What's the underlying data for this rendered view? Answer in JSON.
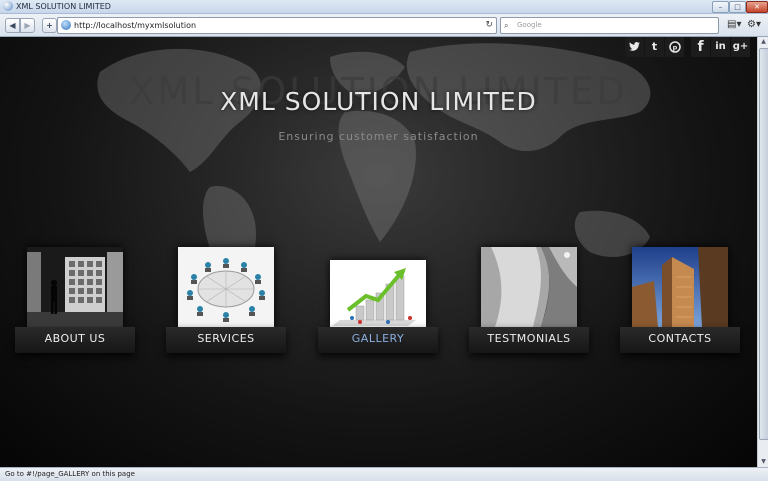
{
  "window": {
    "title": "XML SOLUTION LIMITED",
    "min": "–",
    "max": "□",
    "close": "✕"
  },
  "toolbar": {
    "back": "◀",
    "forward": "▶",
    "add": "+",
    "url": "http://localhost/myxmlsolution",
    "reload": "↻",
    "search_icon": "⌕",
    "search_placeholder": "Google",
    "page_icon": "▤▾",
    "tools_icon": "⚙▾"
  },
  "page": {
    "bg_text": "XML SOLUTION LIMITED",
    "title": "XML SOLUTION LIMITED",
    "tagline": "Ensuring customer satisfaction",
    "social": [
      {
        "icon": "twitter-icon",
        "glyph": "🐦"
      },
      {
        "icon": "tumblr-icon",
        "glyph": "t"
      },
      {
        "icon": "pinterest-icon",
        "glyph": "℗"
      },
      {
        "icon": "facebook-icon",
        "glyph": "f"
      },
      {
        "icon": "linkedin-icon",
        "glyph": "in"
      },
      {
        "icon": "googleplus-icon",
        "glyph": "g+"
      }
    ],
    "nav": [
      {
        "label": "ABOUT US",
        "image": "server-room"
      },
      {
        "label": "SERVICES",
        "image": "meeting-table"
      },
      {
        "label": "GALLERY",
        "image": "growth-chart",
        "active": true
      },
      {
        "label": "TESTMONIALS",
        "image": "white-tunnel"
      },
      {
        "label": "CONTACTS",
        "image": "skyscrapers"
      }
    ],
    "active_color": "#8aaee0"
  },
  "status": "Go to #!/page_GALLERY on this page"
}
